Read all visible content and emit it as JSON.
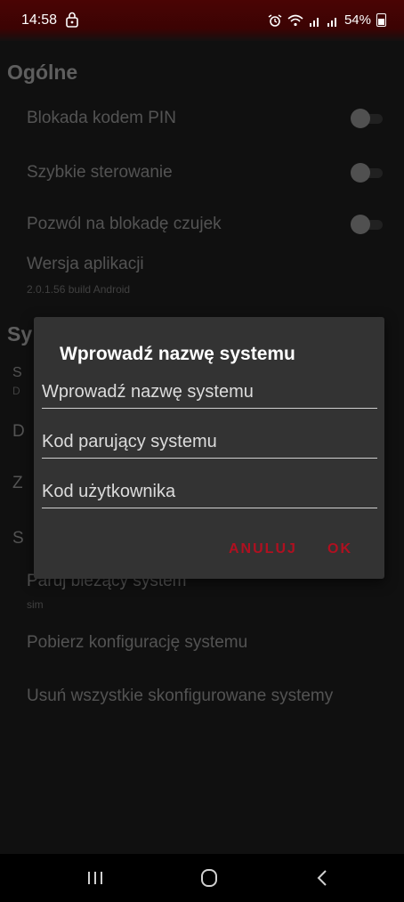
{
  "status_bar": {
    "time": "14:58",
    "battery": "54%"
  },
  "general": {
    "title": "Ogólne",
    "items": [
      {
        "label": "Blokada kodem PIN",
        "toggle": false
      },
      {
        "label": "Szybkie sterowanie",
        "toggle": false
      },
      {
        "label": "Pozwól na blokadę czujek",
        "toggle": false
      }
    ],
    "version": {
      "label": "Wersja aplikacji",
      "value": "2.0.1.56 build Android"
    }
  },
  "system_section": {
    "title_partial": "Sy",
    "row1_partial": "S",
    "row1_sub_partial": "D",
    "row2_partial": "D",
    "row3_partial": "Z",
    "row4_partial": "S",
    "pair": {
      "label": "Paruj bieżący system",
      "sub": "sim"
    },
    "download": "Pobierz konfigurację systemu",
    "remove_all": "Usuń wszystkie skonfigurowane systemy"
  },
  "dialog": {
    "title": "Wprowadź nazwę systemu",
    "fields": [
      {
        "placeholder": "Wprowadź nazwę systemu",
        "value": ""
      },
      {
        "placeholder": "Kod parujący systemu",
        "value": ""
      },
      {
        "placeholder": "Kod użytkownika",
        "value": ""
      }
    ],
    "cancel": "ANULUJ",
    "ok": "OK"
  },
  "colors": {
    "accent": "#b01020",
    "statusbar": "#4a0404",
    "dialog": "#333333"
  },
  "nav_icons": [
    "recent-apps-icon",
    "home-icon",
    "back-icon"
  ]
}
